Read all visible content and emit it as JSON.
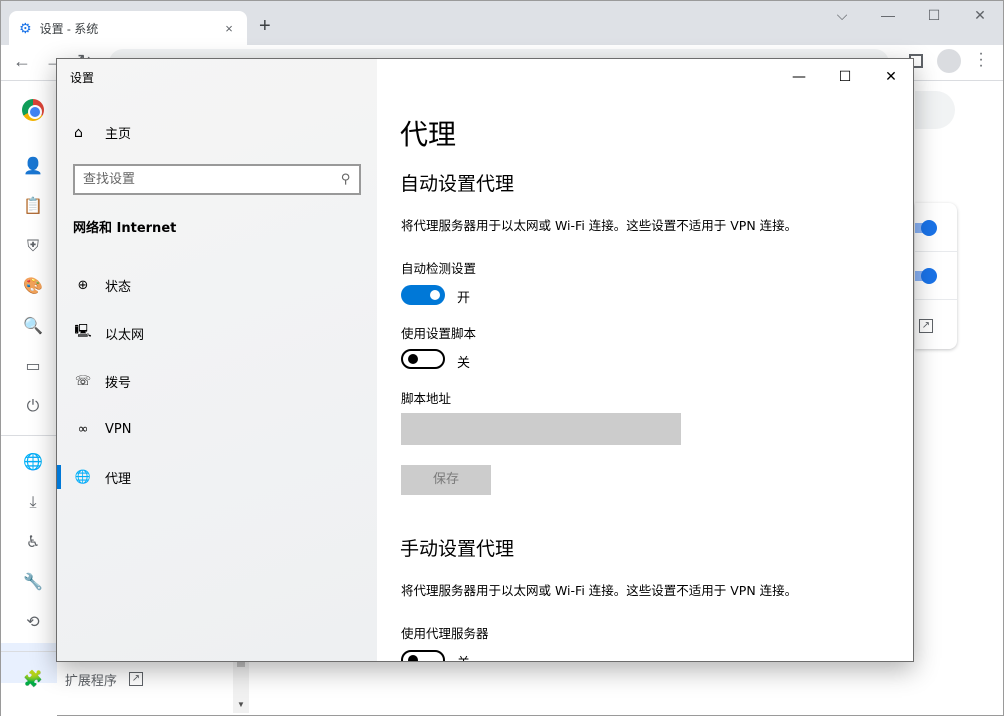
{
  "browser": {
    "tab_title": "设置 - 系统",
    "tab_close": "×",
    "new_tab": "+",
    "window_controls": {
      "dropdown": "⌵",
      "minimize": "—",
      "maximize": "☐",
      "close": "✕"
    },
    "nav": {
      "back": "←",
      "forward": "→",
      "reload": "↻"
    },
    "sidebar_icons": [
      "person-icon",
      "clipboard-icon",
      "shield-icon",
      "palette-icon",
      "search-icon",
      "browser-window-icon",
      "power-icon",
      "globe-icon",
      "download-icon",
      "accessibility-icon",
      "wrench-icon",
      "history-icon"
    ],
    "extensions_label": "扩展程序",
    "accent": "#1a73e8"
  },
  "settings": {
    "window_title": "设置",
    "window_controls": {
      "minimize": "—",
      "maximize": "☐",
      "close": "✕"
    },
    "home_label": "主页",
    "search_placeholder": "查找设置",
    "section_title": "网络和 Internet",
    "nav_items": [
      {
        "label": "状态",
        "icon": "status-globe-icon"
      },
      {
        "label": "以太网",
        "icon": "ethernet-icon"
      },
      {
        "label": "拨号",
        "icon": "dialup-icon"
      },
      {
        "label": "VPN",
        "icon": "vpn-icon"
      },
      {
        "label": "代理",
        "icon": "proxy-globe-icon",
        "selected": true
      }
    ],
    "accent": "#0078d7",
    "page_title": "代理",
    "auto": {
      "heading": "自动设置代理",
      "description": "将代理服务器用于以太网或 Wi-Fi 连接。这些设置不适用于 VPN 连接。",
      "detect_label": "自动检测设置",
      "detect_on": true,
      "detect_state": "开",
      "script_label": "使用设置脚本",
      "script_on": false,
      "script_state": "关",
      "address_label": "脚本地址",
      "address_value": "",
      "save_label": "保存"
    },
    "manual": {
      "heading": "手动设置代理",
      "description": "将代理服务器用于以太网或 Wi-Fi 连接。这些设置不适用于 VPN 连接。",
      "proxy_label": "使用代理服务器",
      "proxy_on": false,
      "proxy_state": "关"
    }
  }
}
